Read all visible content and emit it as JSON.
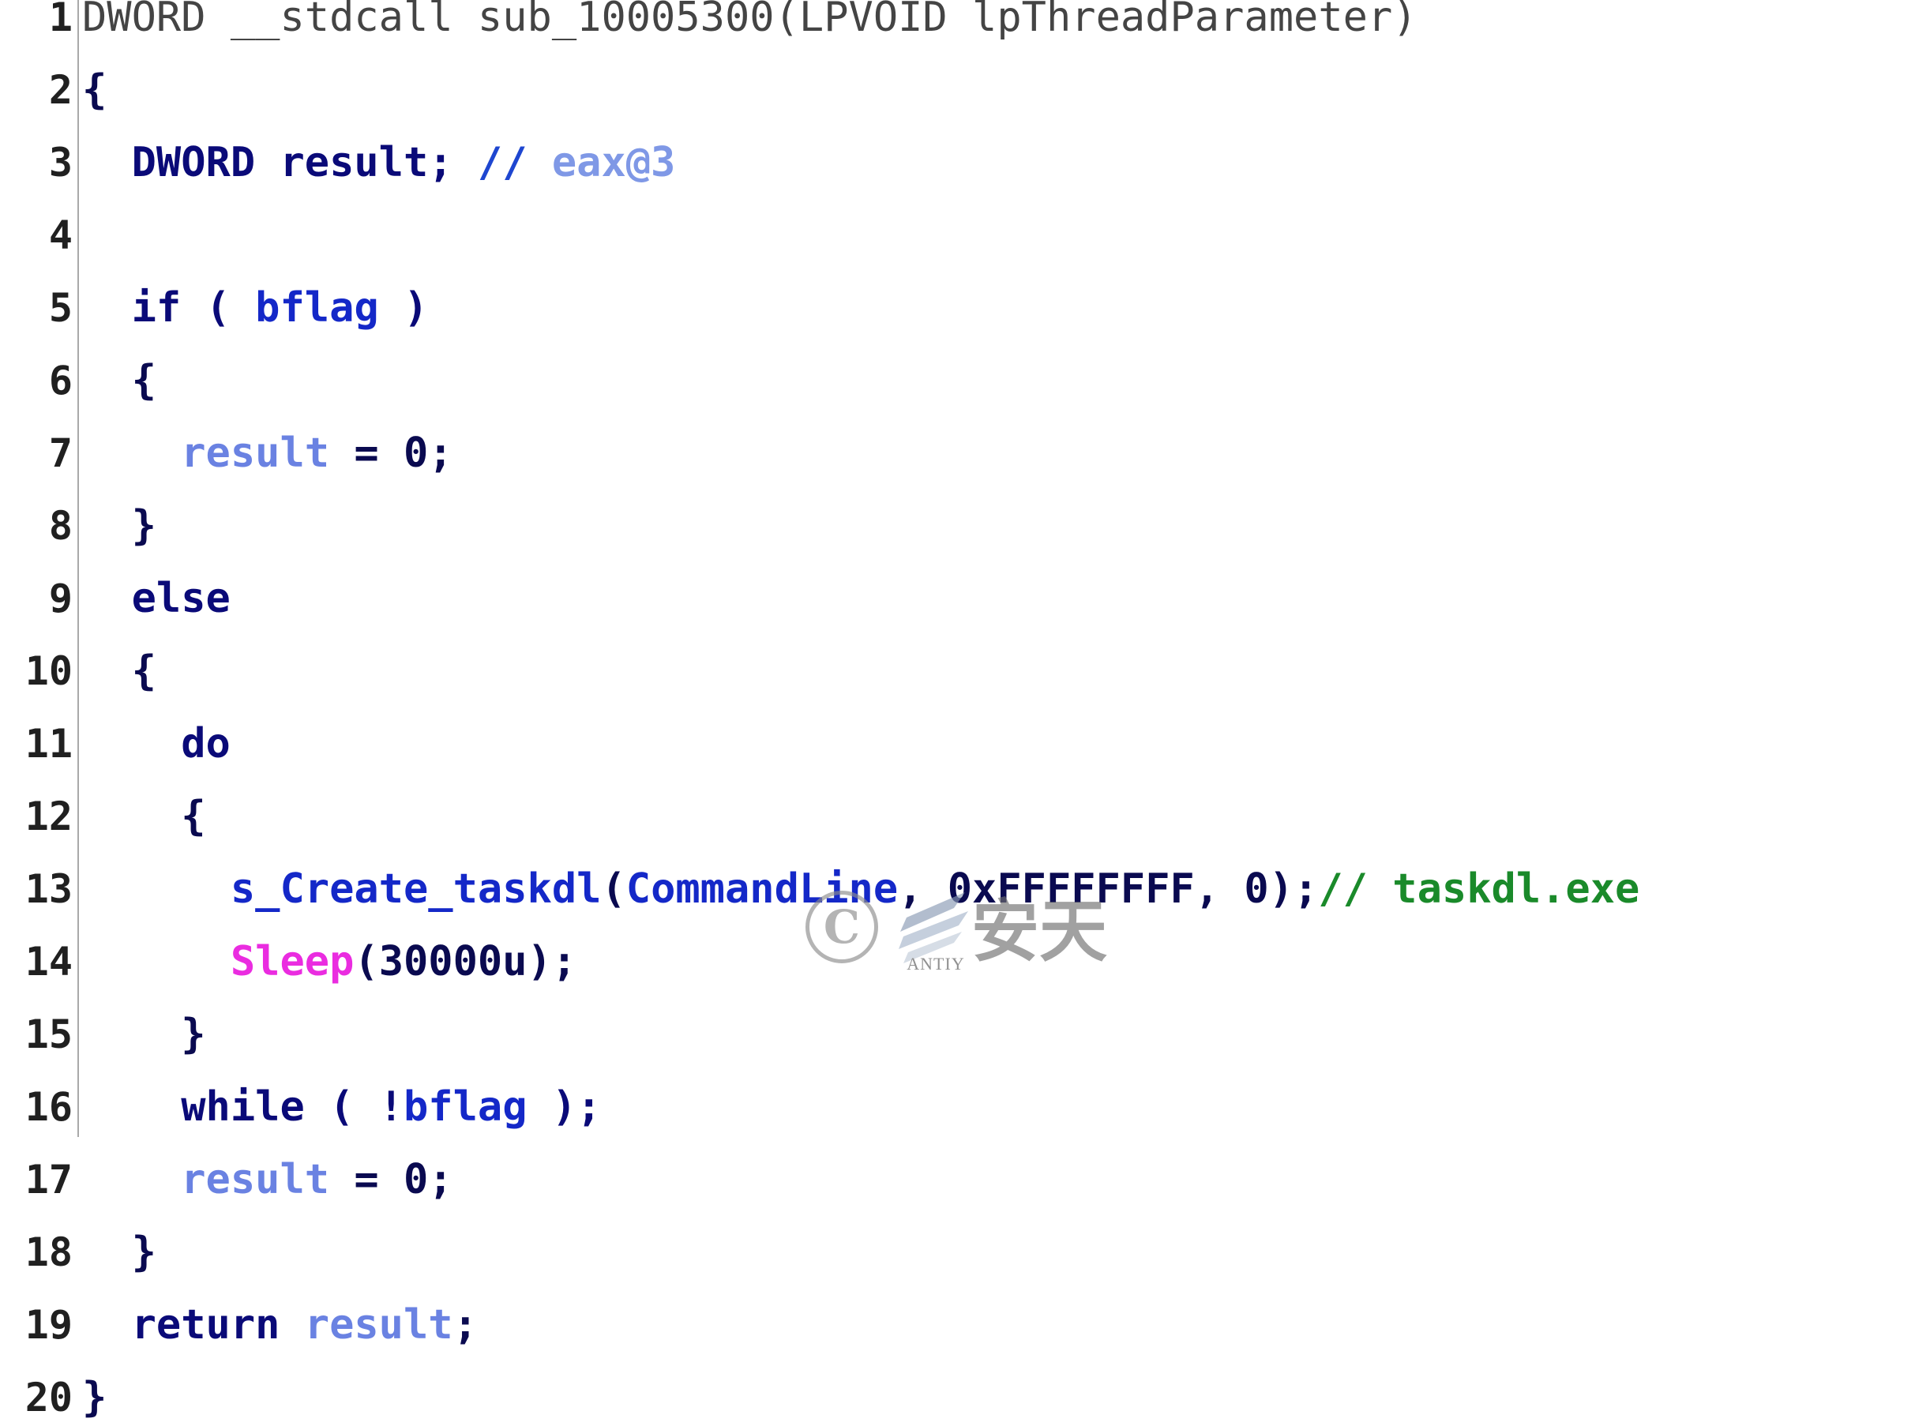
{
  "lines": [
    {
      "n": "1",
      "tokens": [
        {
          "t": "DWORD __stdcall sub_10005300(LPVOID lpThreadParameter)",
          "c": "sig"
        }
      ]
    },
    {
      "n": "2",
      "tokens": [
        {
          "t": "{",
          "c": "punc"
        }
      ]
    },
    {
      "n": "3",
      "tokens": [
        {
          "t": "  DWORD result; ",
          "c": "kw"
        },
        {
          "t": "// ",
          "c": "comment"
        },
        {
          "t": "eax@3",
          "c": "comment-soft"
        }
      ]
    },
    {
      "n": "4",
      "tokens": []
    },
    {
      "n": "5",
      "tokens": [
        {
          "t": "  if ( ",
          "c": "kw"
        },
        {
          "t": "bflag",
          "c": "var"
        },
        {
          "t": " )",
          "c": "kw"
        }
      ]
    },
    {
      "n": "6",
      "tokens": [
        {
          "t": "  {",
          "c": "punc"
        }
      ]
    },
    {
      "n": "7",
      "tokens": [
        {
          "t": "    ",
          "c": "plain"
        },
        {
          "t": "result",
          "c": "local"
        },
        {
          "t": " = 0;",
          "c": "plain"
        }
      ]
    },
    {
      "n": "8",
      "tokens": [
        {
          "t": "  }",
          "c": "punc"
        }
      ]
    },
    {
      "n": "9",
      "tokens": [
        {
          "t": "  else",
          "c": "kw"
        }
      ]
    },
    {
      "n": "10",
      "tokens": [
        {
          "t": "  {",
          "c": "punc"
        }
      ]
    },
    {
      "n": "11",
      "tokens": [
        {
          "t": "    do",
          "c": "kw"
        }
      ]
    },
    {
      "n": "12",
      "tokens": [
        {
          "t": "    {",
          "c": "punc"
        }
      ]
    },
    {
      "n": "13",
      "tokens": [
        {
          "t": "      ",
          "c": "plain"
        },
        {
          "t": "s_Create_taskdl",
          "c": "var"
        },
        {
          "t": "(",
          "c": "plain"
        },
        {
          "t": "CommandLine",
          "c": "var"
        },
        {
          "t": ", 0xFFFFFFFF, 0);",
          "c": "plain"
        },
        {
          "t": "// taskdl.exe",
          "c": "comment-green"
        }
      ]
    },
    {
      "n": "14",
      "tokens": [
        {
          "t": "      ",
          "c": "plain"
        },
        {
          "t": "Sleep",
          "c": "api"
        },
        {
          "t": "(30000u);",
          "c": "plain"
        }
      ]
    },
    {
      "n": "15",
      "tokens": [
        {
          "t": "    }",
          "c": "punc"
        }
      ]
    },
    {
      "n": "16",
      "tokens": [
        {
          "t": "    while ( !",
          "c": "kw"
        },
        {
          "t": "bflag",
          "c": "var"
        },
        {
          "t": " );",
          "c": "kw"
        }
      ]
    },
    {
      "n": "17",
      "tokens": [
        {
          "t": "    ",
          "c": "plain"
        },
        {
          "t": "result",
          "c": "local"
        },
        {
          "t": " = 0;",
          "c": "plain"
        }
      ]
    },
    {
      "n": "18",
      "tokens": [
        {
          "t": "  }",
          "c": "punc"
        }
      ]
    },
    {
      "n": "19",
      "tokens": [
        {
          "t": "  return ",
          "c": "kw"
        },
        {
          "t": "result",
          "c": "local"
        },
        {
          "t": ";",
          "c": "plain"
        }
      ]
    },
    {
      "n": "20",
      "tokens": [
        {
          "t": "}",
          "c": "punc"
        }
      ]
    }
  ],
  "watermark": {
    "copyright_symbol": "C",
    "logo_text": "ANTIY",
    "brand": "安天"
  },
  "colors": {
    "keyword": "#0a0a78",
    "variable": "#1428c8",
    "local": "#6a82e2",
    "comment": "#1e46d0",
    "api": "#ea2ce0",
    "comment_green": "#1a8a2a",
    "gutter_border": "#a9a9a9"
  }
}
